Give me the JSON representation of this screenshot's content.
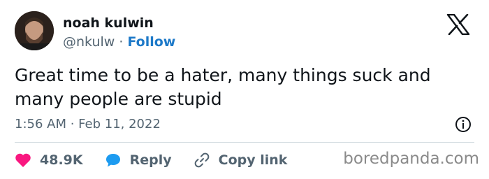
{
  "author": {
    "name": "noah kulwin",
    "handle": "@nkulw",
    "separator": " · ",
    "follow_label": "Follow"
  },
  "tweet": {
    "text": "Great time to be a hater, many things suck and many people are stupid",
    "timestamp": "1:56 AM · Feb 11, 2022"
  },
  "actions": {
    "likes": "48.9K",
    "reply_label": "Reply",
    "copy_link_label": "Copy link"
  },
  "watermark": "boredpanda.com",
  "icons": {
    "logo": "x-logo-icon",
    "info": "info-icon",
    "like": "heart-icon",
    "reply": "speech-bubble-icon",
    "copy": "link-icon"
  },
  "colors": {
    "follow": "#1d79c8",
    "heart": "#f91880",
    "reply": "#1d9bf0",
    "text": "#0f1419",
    "muted": "#536471"
  }
}
